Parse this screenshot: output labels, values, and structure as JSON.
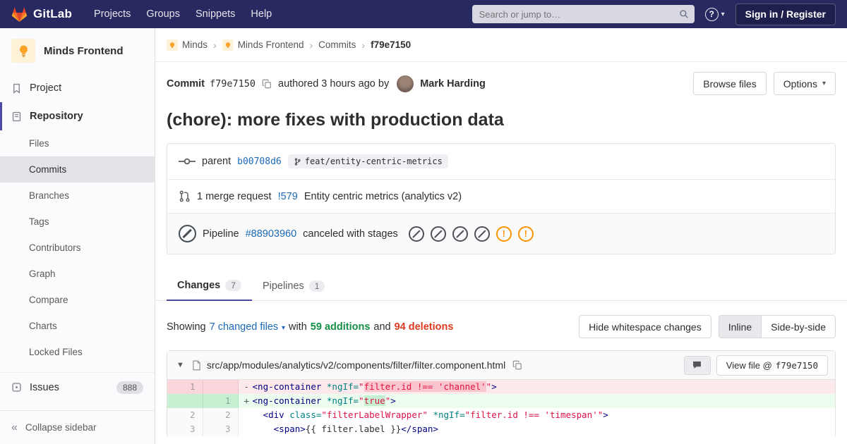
{
  "colors": {
    "navbar_bg": "#292961",
    "accent_indigo": "#4b4ba3",
    "link_blue": "#1b69b6",
    "additions_green": "#168f48",
    "deletions_red": "#db3b21",
    "warning_orange": "#fc9403",
    "removed_line_bg": "#fbe9eb",
    "added_line_bg": "#ecfdf0",
    "tanuki_orange": "#fc6d26",
    "tanuki_red": "#e24329",
    "tanuki_yellow": "#fca326"
  },
  "navbar": {
    "brand": "GitLab",
    "menu": [
      "Projects",
      "Groups",
      "Snippets",
      "Help"
    ],
    "search_placeholder": "Search or jump to…",
    "sign_in_label": "Sign in / Register"
  },
  "sidebar": {
    "project_name": "Minds Frontend",
    "project_item": "Project",
    "repository_item": "Repository",
    "repo_subitems": [
      "Files",
      "Commits",
      "Branches",
      "Tags",
      "Contributors",
      "Graph",
      "Compare",
      "Charts",
      "Locked Files"
    ],
    "issues_label": "Issues",
    "issues_count": "888",
    "collapse_label": "Collapse sidebar"
  },
  "breadcrumb": [
    "Minds",
    "Minds Frontend",
    "Commits",
    "f79e7150"
  ],
  "commit_header": {
    "commit_label": "Commit",
    "sha": "f79e7150",
    "authored_text": "authored 3 hours ago by",
    "author": "Mark Harding",
    "browse_files_label": "Browse files",
    "options_label": "Options"
  },
  "commit_title": "(chore): more fixes with production data",
  "meta": {
    "parent_label": "parent",
    "parent_sha": "b00708d6",
    "branch_name": "feat/entity-centric-metrics",
    "mr_count_text": "1 merge request",
    "mr_ref": "!579",
    "mr_title": "Entity centric metrics (analytics v2)",
    "pipeline_label": "Pipeline",
    "pipeline_id": "#88903960",
    "pipeline_status_text": "canceled with stages",
    "stages": [
      "canceled",
      "canceled",
      "canceled",
      "canceled",
      "warning",
      "warning"
    ]
  },
  "tabs": {
    "changes_label": "Changes",
    "changes_count": "7",
    "pipelines_label": "Pipelines",
    "pipelines_count": "1"
  },
  "diff_bar": {
    "showing": "Showing",
    "changed_files": "7 changed files",
    "with": "with",
    "additions": "59 additions",
    "and": "and",
    "deletions": "94 deletions",
    "hide_whitespace_label": "Hide whitespace changes",
    "inline_label": "Inline",
    "side_by_side_label": "Side-by-side"
  },
  "file_diff": {
    "path": "src/app/modules/analytics/v2/components/filter/filter.component.html",
    "view_file_prefix": "View file @",
    "view_file_sha": "f79e7150",
    "rows": [
      {
        "old": "1",
        "new": "",
        "type": "removed",
        "sign": "-",
        "tokens": [
          [
            "tag",
            "<ng-container "
          ],
          [
            "attr",
            "*ngIf="
          ],
          [
            "str",
            "\""
          ],
          [
            "strhl",
            "filter.id !== 'channel'"
          ],
          [
            "str",
            "\""
          ],
          [
            "tag",
            ">"
          ]
        ]
      },
      {
        "old": "",
        "new": "1",
        "type": "added",
        "sign": "+",
        "tokens": [
          [
            "tag",
            "<ng-container "
          ],
          [
            "attr",
            "*ngIf="
          ],
          [
            "str",
            "\""
          ],
          [
            "strhl",
            "true"
          ],
          [
            "str",
            "\""
          ],
          [
            "tag",
            ">"
          ]
        ]
      },
      {
        "old": "2",
        "new": "2",
        "type": "context",
        "sign": "",
        "tokens": [
          [
            "plain",
            "  "
          ],
          [
            "tag",
            "<div "
          ],
          [
            "attr",
            "class="
          ],
          [
            "str",
            "\"filterLabelWrapper\""
          ],
          [
            "plain",
            " "
          ],
          [
            "attr",
            "*ngIf="
          ],
          [
            "str",
            "\"filter.id !== 'timespan'\""
          ],
          [
            "tag",
            ">"
          ]
        ]
      },
      {
        "old": "3",
        "new": "3",
        "type": "context",
        "sign": "",
        "tokens": [
          [
            "plain",
            "    "
          ],
          [
            "tag",
            "<span>"
          ],
          [
            "plain",
            "{{ filter.label }}"
          ],
          [
            "tag",
            "</span>"
          ]
        ]
      }
    ]
  }
}
